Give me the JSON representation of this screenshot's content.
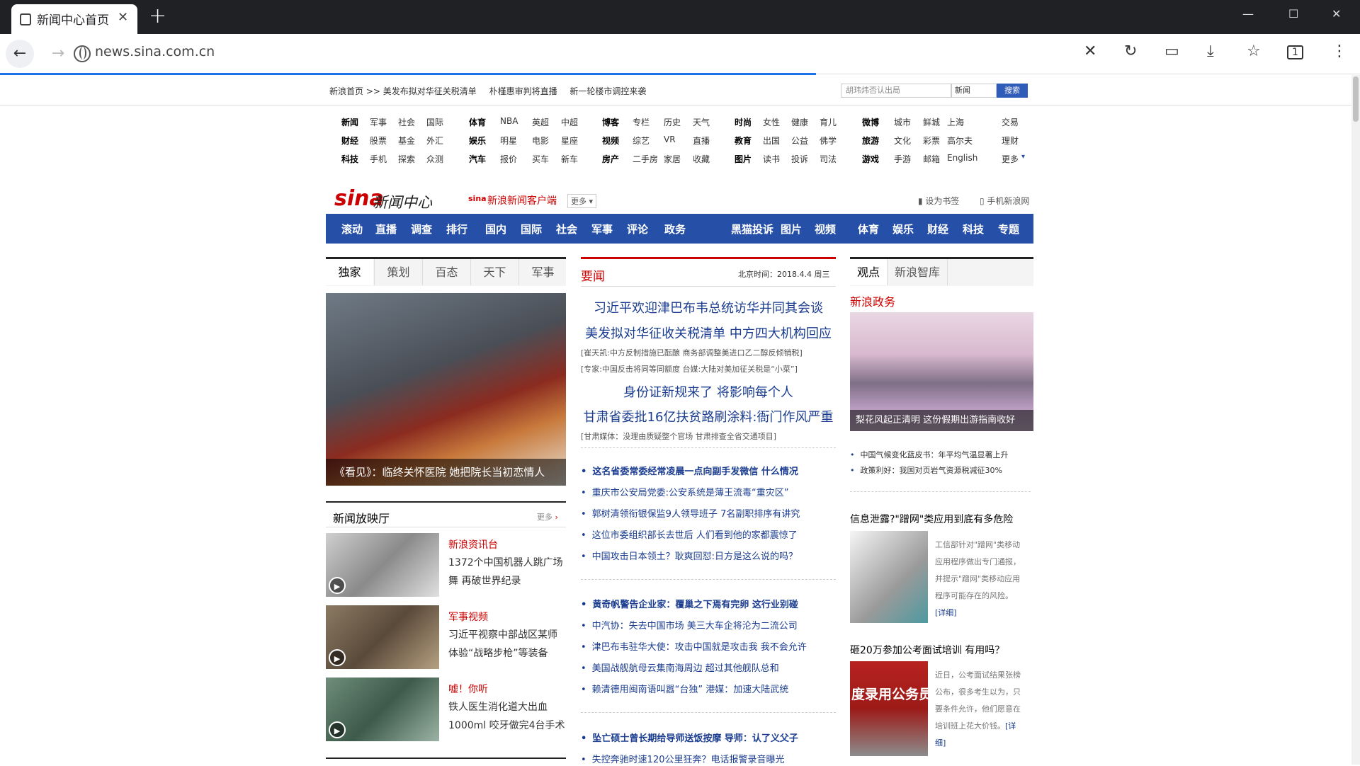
{
  "browser": {
    "tab_title": "新闻中心首页",
    "url": "news.sina.com.cn",
    "accent": "#1a73e8"
  },
  "topbar": {
    "crumbs": [
      "新浪首页 >> 美发布拟对华征关税清单",
      "朴槿惠审判将直播",
      "新一轮楼市调控来袭"
    ],
    "search_placeholder": "胡玮炜否认出局",
    "select_value": "新闻",
    "search_button": "搜索"
  },
  "channels": [
    {
      "row": [
        "新闻",
        "军事",
        "社会",
        "国际"
      ],
      "row2": [
        "财经",
        "股票",
        "基金",
        "外汇"
      ],
      "row3": [
        "科技",
        "手机",
        "探索",
        "众测"
      ]
    },
    {
      "row": [
        "体育",
        "NBA",
        "英超",
        "中超"
      ],
      "row2": [
        "娱乐",
        "明星",
        "电影",
        "星座"
      ],
      "row3": [
        "汽车",
        "报价",
        "买车",
        "新车"
      ]
    },
    {
      "row": [
        "博客",
        "专栏",
        "历史",
        "天气"
      ],
      "row2": [
        "视频",
        "综艺",
        "VR",
        "直播"
      ],
      "row3": [
        "房产",
        "二手房",
        "家居",
        "收藏"
      ]
    },
    {
      "row": [
        "时尚",
        "女性",
        "健康",
        "育儿"
      ],
      "row2": [
        "教育",
        "出国",
        "公益",
        "佛学"
      ],
      "row3": [
        "图片",
        "读书",
        "投诉",
        "司法"
      ]
    },
    {
      "row": [
        "微博",
        "城市",
        "鲜城",
        "上海"
      ],
      "row2": [
        "旅游",
        "文化",
        "彩票",
        "高尔夫"
      ],
      "row3": [
        "游戏",
        "手游",
        "邮箱",
        "English"
      ]
    },
    {
      "row": [
        "交易"
      ],
      "row2": [
        "理财"
      ],
      "row3": [
        "更多"
      ]
    }
  ],
  "header": {
    "logo": "sina",
    "logo_text": "新闻中心",
    "app_link": "新浪新闻客户端",
    "app_more": "更多",
    "bookmark": "设为书签",
    "mobile": "手机新浪网"
  },
  "mainnav": [
    "滚动",
    "直播",
    "调查",
    "排行",
    "国内",
    "国际",
    "社会",
    "军事",
    "评论",
    "政务",
    "黑猫投诉",
    "图片",
    "视频",
    "体育",
    "娱乐",
    "财经",
    "科技",
    "专题"
  ],
  "left": {
    "tabs": [
      "独家",
      "策划",
      "百态",
      "天下",
      "军事"
    ],
    "photo_caption": "《看见》：临终关怀医院 她把院长当初恋情人",
    "video_title": "新闻放映厅",
    "video_more": "更多",
    "videos": [
      {
        "cat": "新浪资讯台",
        "l1": "1372个中国机器人跳广场",
        "l2": "舞 再破世界纪录"
      },
      {
        "cat": "军事视频",
        "l1": "习近平视察中部战区某师",
        "l2": "体验“战略步枪”等装备"
      },
      {
        "cat": "嘘！你听",
        "l1": "铁人医生消化道大出血",
        "l2": "1000ml 咬牙做完4台手术"
      }
    ]
  },
  "center": {
    "title": "要闻",
    "date": "北京时间：2018.4.4 周三",
    "headlines": [
      "习近平欢迎津巴布韦总统访华并同其会谈",
      "美发拟对华征收关税清单 中方四大机构回应",
      "身份证新规来了 将影响每个人",
      "甘肃省委批16亿扶贫路刷涂料:衙门作风严重"
    ],
    "sub1": "[崔天凯:中方反制措施已酝酿 商务部调整美进口乙二醇反倾销税]",
    "sub2": "[专家:中国反击将同等同额度 台媒:大陆对美加征关税是“小菜”]",
    "sub3": "[甘肃媒体：没理由质疑整个官场 甘肃排查全省交通项目]",
    "group1": [
      "这名省委常委经常凌晨一点向副手发微信 什么情况",
      "重庆市公安局党委:公安系统是薄王流毒“重灾区”",
      "郭树清领衔银保监9人领导班子 7名副职排序有讲究",
      "这位市委组织部长去世后 人们看到他的家都震惊了",
      "中国攻击日本领土？耿爽回怼:日方是这么说的吗？"
    ],
    "group2": [
      "黄奇帆警告企业家：覆巢之下焉有完卵 这行业别碰",
      "中汽协：失去中国市场 美三大车企将沦为二流公司",
      "津巴布韦驻华大使：攻击中国就是攻击我 我不会允许",
      "美国战舰航母云集南海周边 超过其他舰队总和",
      "赖清德用闽南语叫嚣“台独” 港媒：加速大陆武统"
    ],
    "group3": [
      "坠亡硕士曾长期给导师送饭按摩 导师：认了义父子",
      "失控奔驰时速120公里狂奔？电话报警录音曝光"
    ]
  },
  "right": {
    "tabs": [
      "观点",
      "新浪智库"
    ],
    "section": "新浪政务",
    "photo_caption": "梨花风起正清明 这份假期出游指南收好",
    "bullets": [
      "中国气候变化蓝皮书：年平均气温显著上升",
      "政策利好：我国对页岩气资源税减征30%"
    ],
    "story1_title": "信息泄露?\"蹭网\"类应用到底有多危险",
    "story1_text": "工信部针对\"蹭网\"类移动应用程序做出专门通报，并提示\"蹭网\"类移动应用程序可能存在的风险。",
    "story2_title": "砸20万参加公考面试培训 有用吗？",
    "story2_text": "近日，公考面试结果张榜公布，很多考生以为，只要条件允许，他们愿意在培训班上花大价钱。",
    "more": "[详细]",
    "img2_text": "度录用公务员"
  }
}
